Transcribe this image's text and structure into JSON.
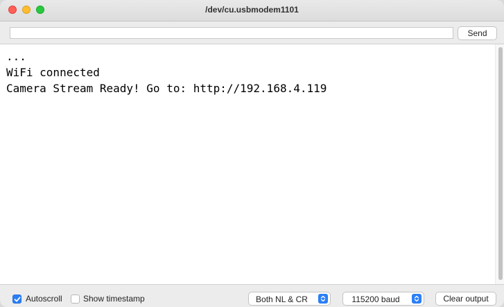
{
  "window": {
    "title": "/dev/cu.usbmodem1101"
  },
  "send_bar": {
    "input_value": "",
    "input_placeholder": "",
    "send_label": "Send"
  },
  "output": {
    "lines": [
      "...",
      "WiFi connected",
      "Camera Stream Ready! Go to: http://192.168.4.119"
    ]
  },
  "bottom_bar": {
    "autoscroll": {
      "label": "Autoscroll",
      "checked": true
    },
    "show_timestamp": {
      "label": "Show timestamp",
      "checked": false
    },
    "line_ending": {
      "selected": "Both NL & CR"
    },
    "baud_rate": {
      "selected": "115200 baud"
    },
    "clear_label": "Clear output"
  },
  "colors": {
    "accent": "#2a7ff6",
    "close": "#ff5f57",
    "minimize": "#febc2e",
    "maximize": "#28c840"
  },
  "icons": [
    "close-icon",
    "minimize-icon",
    "maximize-icon",
    "checkmark-icon",
    "chevron-updown-icon"
  ]
}
